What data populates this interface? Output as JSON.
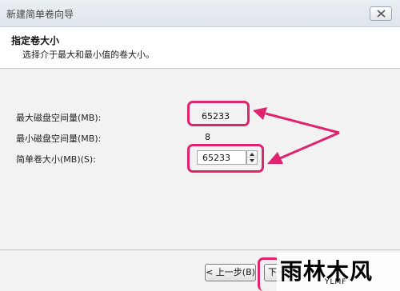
{
  "window": {
    "title": "新建简单卷向导"
  },
  "header": {
    "title": "指定卷大小",
    "subtitle": "选择介于最大和最小值的卷大小。"
  },
  "form": {
    "max_label": "最大磁盘空间量(MB):",
    "max_value": "65233",
    "min_label": "最小磁盘空间量(MB):",
    "min_value": "8",
    "size_label": "简单卷大小(MB)(S):",
    "size_value": "65233"
  },
  "buttons": {
    "back": "< 上一步(B)",
    "next": "下一"
  },
  "watermark": {
    "logo": "雨林木风",
    "sub": "YLMF"
  },
  "colors": {
    "highlight": "#e0236f"
  }
}
